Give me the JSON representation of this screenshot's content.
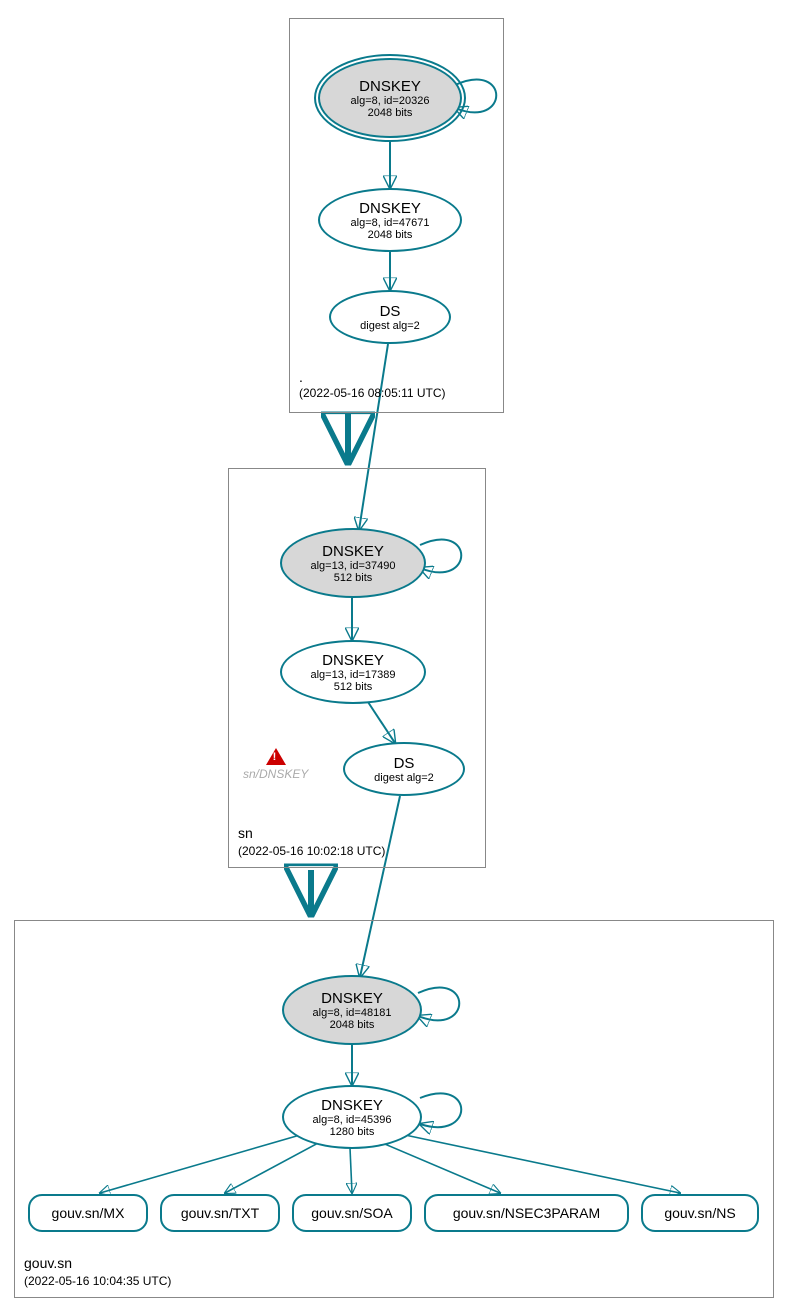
{
  "zones": {
    "root": {
      "name": ".",
      "timestamp": "(2022-05-16 08:05:11 UTC)",
      "dnskey_ksk": {
        "title": "DNSKEY",
        "line2": "alg=8, id=20326",
        "line3": "2048 bits"
      },
      "dnskey_zsk": {
        "title": "DNSKEY",
        "line2": "alg=8, id=47671",
        "line3": "2048 bits"
      },
      "ds": {
        "title": "DS",
        "line2": "digest alg=2"
      }
    },
    "sn": {
      "name": "sn",
      "timestamp": "(2022-05-16 10:02:18 UTC)",
      "dnskey_ksk": {
        "title": "DNSKEY",
        "line2": "alg=13, id=37490",
        "line3": "512 bits"
      },
      "dnskey_zsk": {
        "title": "DNSKEY",
        "line2": "alg=13, id=17389",
        "line3": "512 bits"
      },
      "ds": {
        "title": "DS",
        "line2": "digest alg=2"
      },
      "warn": "sn/DNSKEY"
    },
    "gouv": {
      "name": "gouv.sn",
      "timestamp": "(2022-05-16 10:04:35 UTC)",
      "dnskey_ksk": {
        "title": "DNSKEY",
        "line2": "alg=8, id=48181",
        "line3": "2048 bits"
      },
      "dnskey_zsk": {
        "title": "DNSKEY",
        "line2": "alg=8, id=45396",
        "line3": "1280 bits"
      },
      "records": [
        "gouv.sn/MX",
        "gouv.sn/TXT",
        "gouv.sn/SOA",
        "gouv.sn/NSEC3PARAM",
        "gouv.sn/NS"
      ]
    }
  }
}
